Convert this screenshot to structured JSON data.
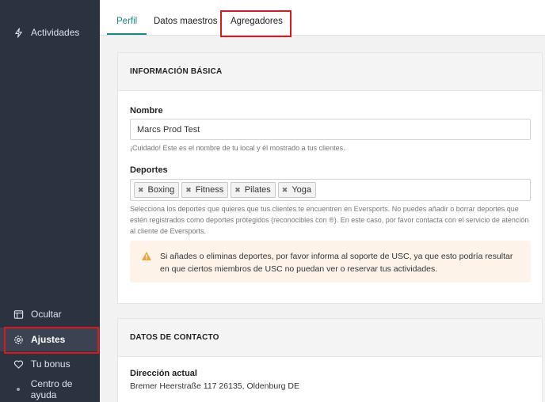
{
  "sidebar": {
    "items": {
      "actividades": "Actividades",
      "ocultar": "Ocultar",
      "ajustes": "Ajustes",
      "bonus": "Tu bonus",
      "ayuda": "Centro de ayuda"
    },
    "icons": [
      "bolt-icon",
      "panel-icon",
      "gear-icon",
      "heart-icon",
      "dot-icon"
    ]
  },
  "tabs": {
    "perfil": "Perfil",
    "datos": "Datos maestros",
    "agregadores": "Agregadores"
  },
  "basic": {
    "header": "INFORMACIÓN BÁSICA",
    "name_label": "Nombre",
    "name_value": "Marcs Prod Test",
    "name_hint": "¡Cuidado! Este es el nombre de tu local y él mostrado a tus clientes.",
    "sports_label": "Deportes",
    "tags": [
      "Boxing",
      "Fitness",
      "Pilates",
      "Yoga"
    ],
    "sports_hint": "Selecciona los deportes que quieres que tus clientes te encuentren en Eversports. No puedes añadir o borrar deportes que estén registrados como deportes protegidos (reconocibles con ®). En este caso, por favor contacta con el servicio de atención al cliente de Eversports.",
    "warning": "Si añades o eliminas deportes, por favor informa al soporte de USC, ya que esto podría resultar en que ciertos miembros de USC no puedan ver o reservar tus actividades."
  },
  "contact": {
    "header": "DATOS DE CONTACTO",
    "address_label": "Dirección actual",
    "address_value": "Bremer Heerstraße 117 26135, Oldenburg DE"
  },
  "colors": {
    "sidebar_bg": "#2b3240",
    "accent": "#1b8a86",
    "highlight": "#e0161d",
    "warning_bg": "#fdf3e9",
    "warning_icon": "#f0a33a"
  }
}
